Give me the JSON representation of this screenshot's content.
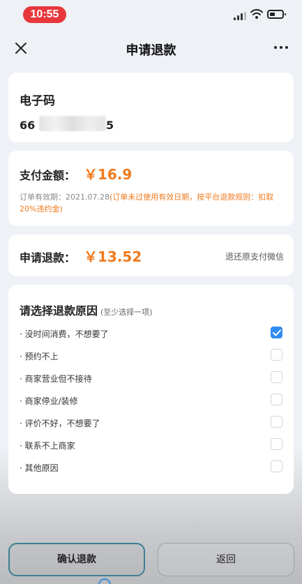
{
  "status_bar": {
    "time": "10:55"
  },
  "nav": {
    "title": "申请退款"
  },
  "code_card": {
    "label": "电子码",
    "value_prefix": "66",
    "value_suffix": "5"
  },
  "pay_card": {
    "label": "支付金额：",
    "amount": "￥16.9",
    "validity_prefix": "订单有效期：2021.07.28",
    "validity_warning": "(订单未过使用有效日期，按平台退款规则：扣取20%违约金)"
  },
  "refund_card": {
    "label": "申请退款：",
    "amount": "￥13.52",
    "method": "退还原支付微信"
  },
  "reasons": {
    "title": "请选择退款原因",
    "hint": "(至少选择一项)",
    "items": [
      {
        "label": "· 没时间消费，不想要了",
        "checked": true
      },
      {
        "label": "· 预约不上",
        "checked": false
      },
      {
        "label": "· 商家营业但不接待",
        "checked": false
      },
      {
        "label": "· 商家停业/装修",
        "checked": false
      },
      {
        "label": "· 评价不好，不想要了",
        "checked": false
      },
      {
        "label": "· 联系不上商家",
        "checked": false
      },
      {
        "label": "· 其他原因",
        "checked": false
      }
    ]
  },
  "buttons": {
    "confirm": "确认退款",
    "back": "返回"
  },
  "colors": {
    "accent": "#f07a1e",
    "check": "#2f8cf0",
    "status_pill": "#e8383b"
  }
}
